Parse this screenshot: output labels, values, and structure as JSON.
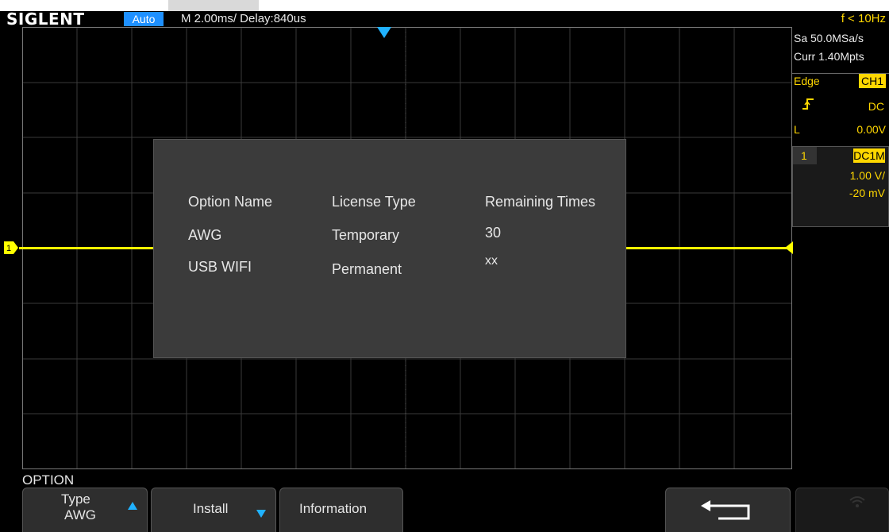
{
  "status_bar": {
    "logo": "SIGLENT",
    "trigger_mode": "Auto",
    "timebase": "M 2.00ms/ Delay:840us",
    "frequency": "f < 10Hz"
  },
  "acquisition": {
    "sample_rate": "Sa 50.0MSa/s",
    "memory_depth": "Curr 1.40Mpts"
  },
  "trigger": {
    "type": "Edge",
    "source": "CH1",
    "slope_icon": "rising-edge-icon",
    "coupling": "DC",
    "level_prefix": "L",
    "level": "0.00V"
  },
  "channel": {
    "number": "1",
    "coupling": "DC1M",
    "scale": "1.00 V/",
    "offset": "-20 mV",
    "marker_label": "1"
  },
  "dialog": {
    "headers": [
      "Option Name",
      "License Type",
      "Remaining Times"
    ],
    "rows": [
      [
        "AWG",
        "Temporary",
        "30"
      ],
      [
        "USB WIFI",
        "Permanent",
        "xx"
      ]
    ]
  },
  "menu": {
    "title": "OPTION",
    "softkeys": [
      {
        "label": "Type",
        "sub": "AWG"
      },
      {
        "label": "Install"
      },
      {
        "label": "Information"
      },
      {
        "label": "",
        "icon": "return-icon"
      },
      {
        "label": "",
        "icon": "wifi-icon"
      }
    ]
  },
  "colors": {
    "channel1": "#ffff00",
    "trigger_accent": "#20b2ff",
    "label_yellow": "#ffd700",
    "dialog_bg": "#3b3b3b"
  }
}
